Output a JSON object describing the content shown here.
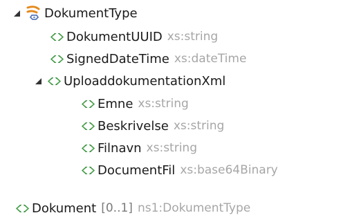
{
  "tree": {
    "root": {
      "name": "DokumentType",
      "expanded": true,
      "icon": "complex-type-icon",
      "children": [
        {
          "name": "DokumentUUID",
          "type": "xs:string",
          "icon": "element-icon"
        },
        {
          "name": "SignedDateTime",
          "type": "xs:dateTime",
          "icon": "element-icon"
        },
        {
          "name": "UploaddokumentationXml",
          "expanded": true,
          "icon": "element-icon",
          "children": [
            {
              "name": "Emne",
              "type": "xs:string",
              "icon": "element-icon"
            },
            {
              "name": "Beskrivelse",
              "type": "xs:string",
              "icon": "element-icon"
            },
            {
              "name": "Filnavn",
              "type": "xs:string",
              "icon": "element-icon"
            },
            {
              "name": "DocumentFil",
              "type": "xs:base64Binary",
              "icon": "element-icon"
            }
          ]
        }
      ]
    }
  },
  "element": {
    "name": "Dokument",
    "multiplicity": "[0..1]",
    "type": "ns1:DokumentType",
    "icon": "element-icon"
  },
  "colors": {
    "text": "#1a1a1a",
    "type_text": "#a6a6a6",
    "element_icon": "#2d8a33",
    "complex_icon_orange": "#e48a1e",
    "complex_icon_blue": "#5577bb"
  }
}
